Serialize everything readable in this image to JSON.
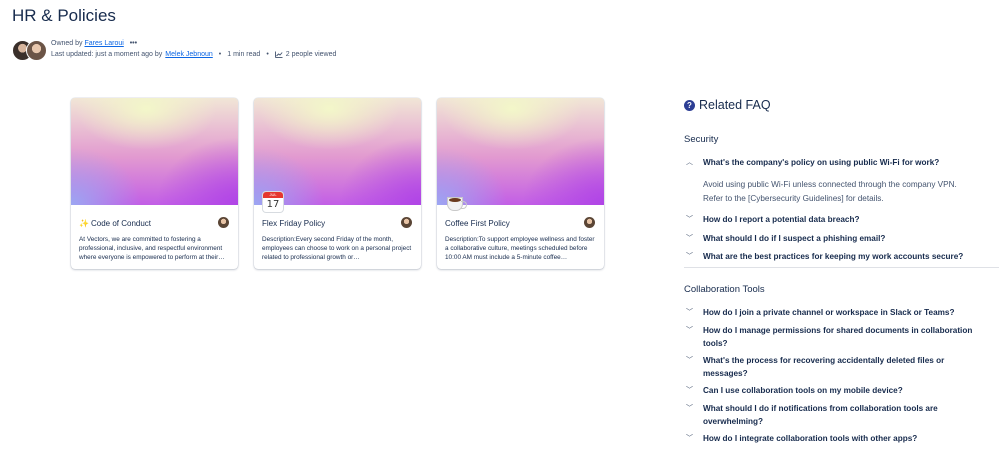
{
  "page": {
    "title": "HR & Policies",
    "owned_by_label": "Owned by",
    "owner": "Fares Laroui",
    "more": "•••",
    "updated_label": "Last updated: just a moment ago by",
    "updated_by": "Melek Jebnoun",
    "read_time": "1 min read",
    "views": "2 people viewed"
  },
  "cards": [
    {
      "icon": "sparkles-icon",
      "emoji": "✨",
      "title": "Code of Conduct",
      "description": "At Vectors, we are committed to fostering a professional, inclusive, and respectful environment where everyone is empowered to perform at their…"
    },
    {
      "icon": "calendar-icon",
      "calendar_month": "JUL",
      "calendar_day": "17",
      "title": "Flex Friday Policy",
      "description": "Description:Every second Friday of the month, employees can choose to work on a personal project related to professional growth or…"
    },
    {
      "icon": "coffee-icon",
      "title": "Coffee First Policy",
      "description": "Description:To support employee wellness and foster a collaborative culture, meetings scheduled before 10:00 AM must include a 5-minute coffee…"
    }
  ],
  "faq": {
    "title": "Related FAQ",
    "sections": [
      {
        "title": "Security",
        "items": [
          {
            "question": "What's the company's policy on using public Wi-Fi for work?",
            "expanded": true,
            "answer": "Avoid using public Wi-Fi unless connected through the company VPN. Refer to the [Cybersecurity Guidelines] for details."
          },
          {
            "question": "How do I report a potential data breach?",
            "expanded": false
          },
          {
            "question": "What should I do if I suspect a phishing email?",
            "expanded": false
          },
          {
            "question": "What are the best practices for keeping my work accounts secure?",
            "expanded": false
          }
        ]
      },
      {
        "title": "Collaboration Tools",
        "items": [
          {
            "question": "How do I join a private channel or workspace in Slack or Teams?",
            "expanded": false
          },
          {
            "question": "How do I manage permissions for shared documents in collaboration tools?",
            "expanded": false
          },
          {
            "question": "What's the process for recovering accidentally deleted files or messages?",
            "expanded": false
          },
          {
            "question": "Can I use collaboration tools on my mobile device?",
            "expanded": false
          },
          {
            "question": "What should I do if notifications from collaboration tools are overwhelming?",
            "expanded": false
          },
          {
            "question": "How do I integrate collaboration tools with other apps?",
            "expanded": false
          }
        ]
      }
    ]
  },
  "colors": {
    "text": "#172b4d",
    "link": "#0c66e4",
    "subtle": "#44546f",
    "faq_icon": "#2c3e94"
  }
}
